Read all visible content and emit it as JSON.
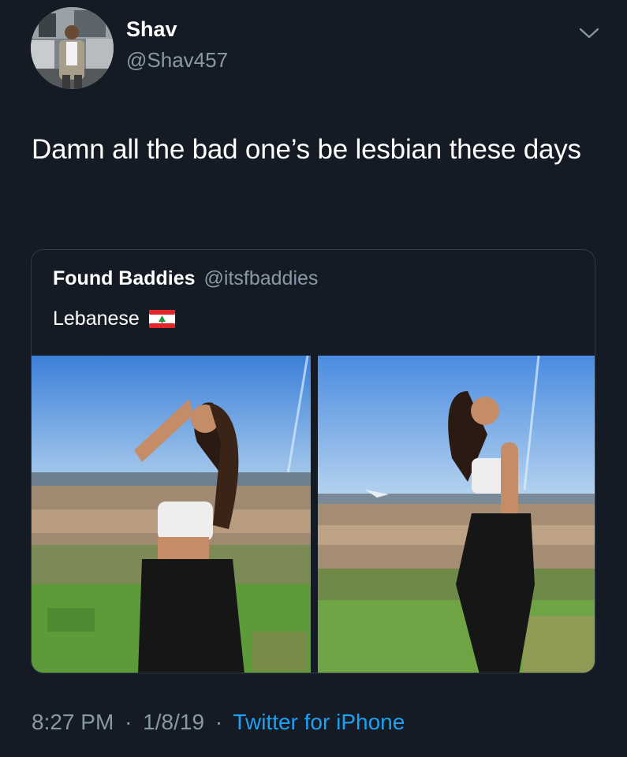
{
  "author": {
    "name": "Shav",
    "handle": "@Shav457",
    "avatar_icon": "profile-photo"
  },
  "tweet": {
    "text": "Damn all the bad one’s be lesbian these days"
  },
  "quoted_tweet": {
    "name": "Found Baddies",
    "handle": "@itsfbaddies",
    "text": "Lebanese",
    "emoji_icon": "lebanon-flag-icon",
    "photos": [
      {
        "description_icon": "photo-woman-hillside-1"
      },
      {
        "description_icon": "photo-woman-hillside-2"
      }
    ]
  },
  "meta": {
    "time": "8:27 PM",
    "date": "1/8/19",
    "separator": "·",
    "source": "Twitter for iPhone"
  },
  "colors": {
    "background": "#141b24",
    "text": "#ffffff",
    "secondary": "#8899a6",
    "link": "#1da1f2",
    "border": "#2f3b47"
  }
}
